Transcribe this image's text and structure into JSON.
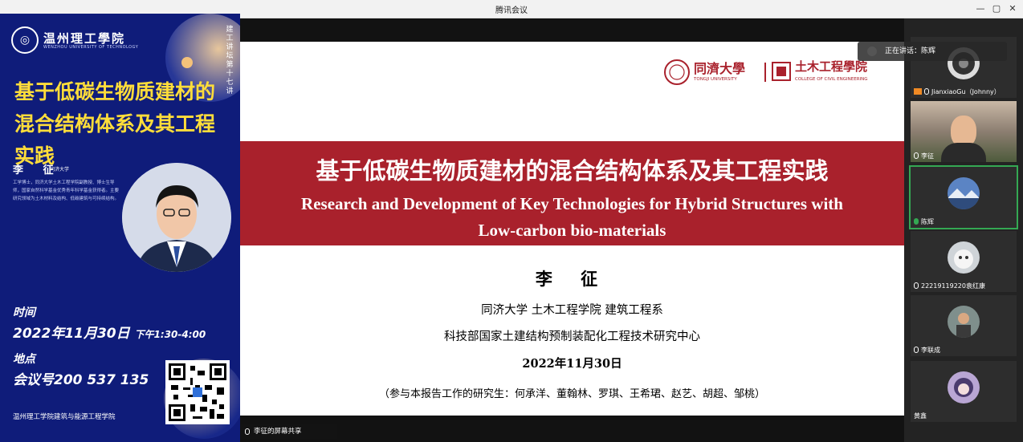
{
  "window": {
    "title": "腾讯会议",
    "controls": [
      "—",
      "▢",
      "✕"
    ]
  },
  "poster": {
    "school_name": "温州理工學院",
    "school_name_en": "WENZHOU UNIVERSITY OF TECHNOLOGY",
    "series": "建工讲坛第十七讲",
    "title_line1": "基于低碳生物质建材的",
    "title_line2": "混合结构体系及其工程实践",
    "speaker_name": "李 征",
    "speaker_affiliation": "同济大学",
    "bio": "工学博士，同济大学土木工程学院副教授、博士生导师，国家自然科学基金优秀青年科学基金获得者。主要研究领域为土木材料及结构、低碳建筑与可持续结构。",
    "time_label": "时间",
    "time_value": "2022年11月30日",
    "time_range": "下午1:30-4:00",
    "place_label": "地点",
    "place_value": "会议号200 537 135",
    "footer": "温州理工学院建筑与能源工程学院"
  },
  "slide": {
    "logo_tongji": "同濟大學",
    "logo_tongji_en": "TONGJI UNIVERSITY",
    "logo_college": "土木工程學院",
    "logo_college_en": "COLLEGE OF CIVIL ENGINEERING",
    "title_zh": "基于低碳生物质建材的混合结构体系及其工程实践",
    "title_en_line1": "Research and Development of Key Technologies for Hybrid Structures with",
    "title_en_line2": "Low-carbon bio-materials",
    "presenter": "李 征",
    "affiliation": "同济大学 土木工程学院 建筑工程系",
    "center": "科技部国家土建结构预制装配化工程技术研究中心",
    "date": "2022年11月30日",
    "contributors": "（参与本报告工作的研究生：何承洋、董翰林、罗琪、王希珺、赵艺、胡超、邹桃）"
  },
  "speaking": "正在讲话：陈辉",
  "share_label": "李征的屏幕共享",
  "participants": [
    {
      "name": "JianxiaoGu（Johnny）"
    },
    {
      "name": "李征"
    },
    {
      "name": "陈辉"
    },
    {
      "name": "22219119220袁红康"
    },
    {
      "name": "李联成"
    },
    {
      "name": "黄鑫"
    }
  ]
}
